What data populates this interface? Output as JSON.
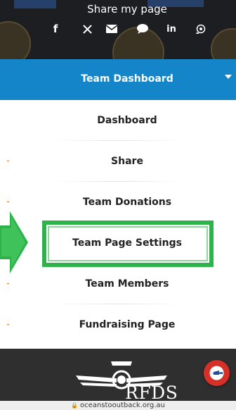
{
  "share": {
    "title": "Share my page",
    "icons": [
      "facebook-icon",
      "x-icon",
      "email-icon",
      "chat-icon",
      "linkedin-icon",
      "whatsapp-icon"
    ],
    "linkedin_text": "in"
  },
  "dashboard": {
    "header_label": "Team Dashboard",
    "items": [
      {
        "label": "Dashboard"
      },
      {
        "label": "Share"
      },
      {
        "label": "Team Donations"
      },
      {
        "label": "Team Page Settings"
      },
      {
        "label": "Team Members"
      },
      {
        "label": "Fundraising Page"
      }
    ]
  },
  "footer": {
    "logo_text": "RFDS"
  },
  "browser": {
    "url": "oceanstooutback.org.au"
  },
  "colors": {
    "header_blue": "#1585c9",
    "highlight_green": "#2db34a",
    "help_red": "#d63128"
  }
}
